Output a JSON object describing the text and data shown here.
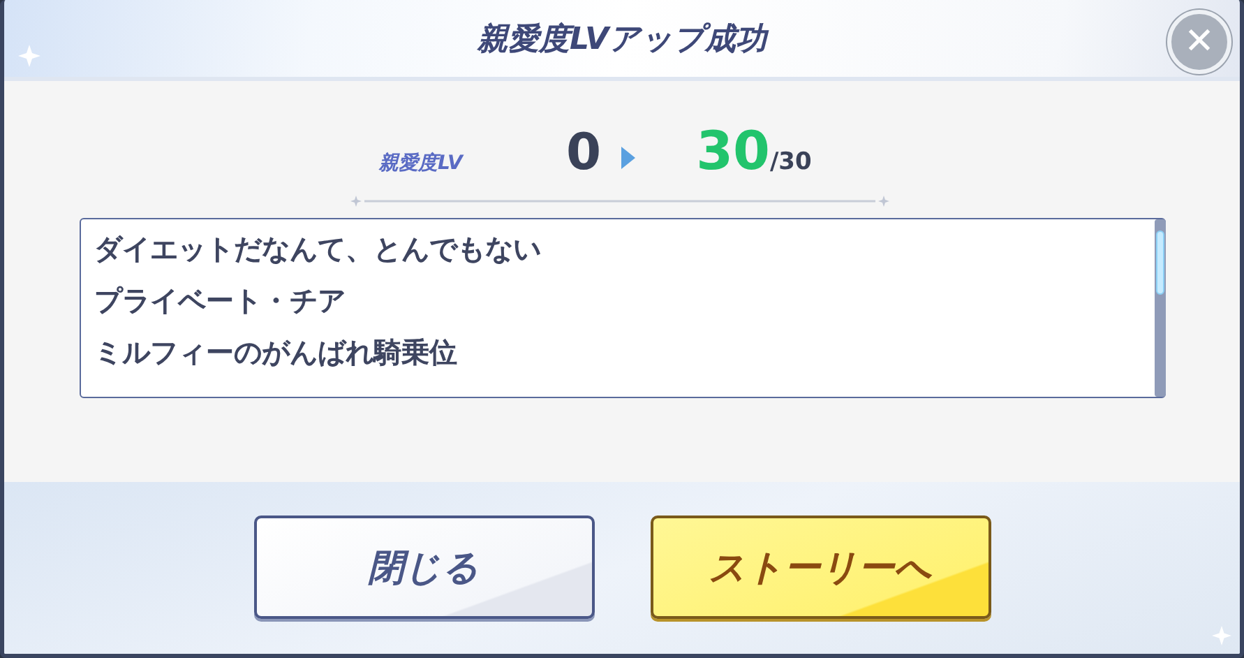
{
  "dialog": {
    "title": "親愛度LVアップ成功",
    "close_glyph": "✕"
  },
  "level": {
    "label": "親愛度LV",
    "from": "0",
    "to": "30",
    "max": "/30"
  },
  "stories": [
    "ダイエットだなんて、とんでもない",
    "プライベート・チア",
    "ミルフィーのがんばれ騎乗位"
  ],
  "buttons": [
    {
      "label": "閉じる",
      "kind": "secondary"
    },
    {
      "label": "ストーリーへ",
      "kind": "primary"
    }
  ]
}
